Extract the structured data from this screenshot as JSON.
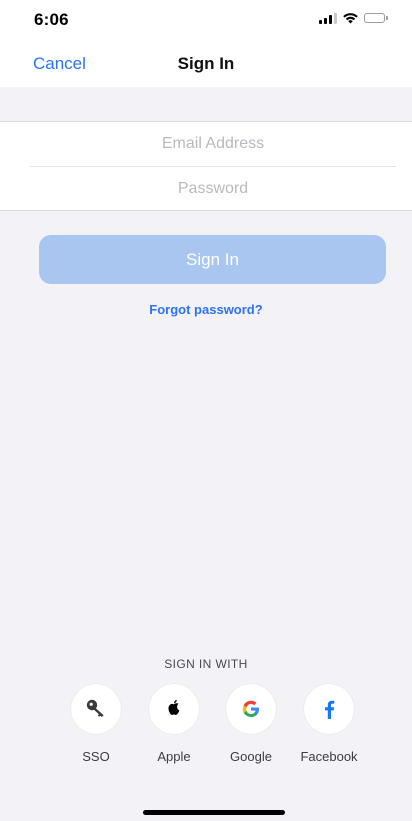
{
  "status_bar": {
    "time": "6:06",
    "signal_icon": "cellular-signal-icon",
    "wifi_icon": "wifi-icon",
    "battery_icon": "battery-icon",
    "battery_level": 0.0
  },
  "nav": {
    "cancel_label": "Cancel",
    "title": "Sign In"
  },
  "form": {
    "email": {
      "value": "",
      "placeholder": "Email Address"
    },
    "password": {
      "value": "",
      "placeholder": "Password"
    }
  },
  "signin_button": {
    "label": "Sign In",
    "enabled": false
  },
  "forgot_password_label": "Forgot password?",
  "sign_in_with_heading": "SIGN IN WITH",
  "social": [
    {
      "id": "sso",
      "label": "SSO",
      "icon": "key-icon"
    },
    {
      "id": "apple",
      "label": "Apple",
      "icon": "apple-icon"
    },
    {
      "id": "google",
      "label": "Google",
      "icon": "google-icon"
    },
    {
      "id": "facebook",
      "label": "Facebook",
      "icon": "facebook-icon"
    }
  ],
  "colors": {
    "accent": "#2d73f5",
    "button_disabled": "#a8c6f0",
    "background": "#f2f2f7",
    "placeholder": "#b9b9bf",
    "google_blue": "#4285f4",
    "google_red": "#ea4335",
    "google_yellow": "#fbbc05",
    "google_green": "#34a853",
    "facebook_blue": "#1877f2"
  }
}
